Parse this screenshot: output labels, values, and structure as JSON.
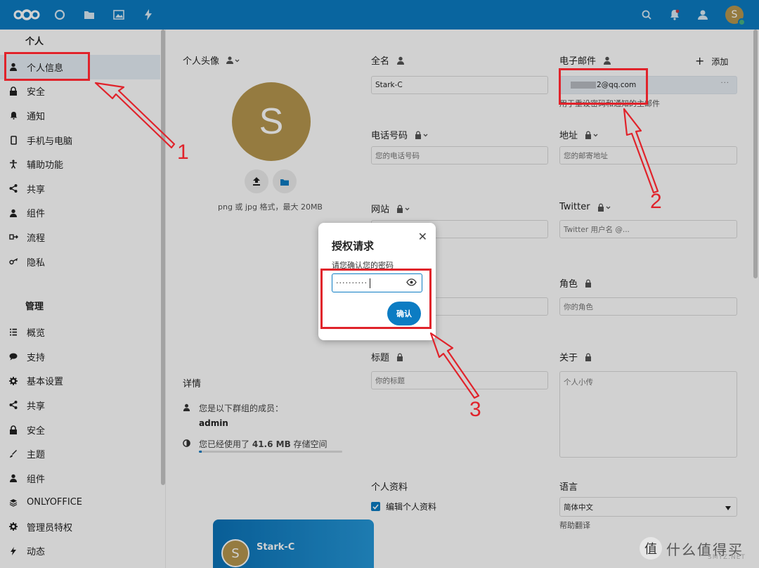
{
  "header": {
    "icons": [
      "nextcloud-logo-icon",
      "dashboard-icon",
      "files-icon",
      "photos-icon",
      "activity-icon",
      "search-icon",
      "notifications-icon",
      "contacts-icon"
    ],
    "avatar_letter": "S"
  },
  "sidebar": {
    "personal_heading": "个人",
    "personal_items": [
      {
        "label": "个人信息",
        "icon": "user-icon"
      },
      {
        "label": "安全",
        "icon": "lock-icon"
      },
      {
        "label": "通知",
        "icon": "bell-icon"
      },
      {
        "label": "手机与电脑",
        "icon": "phone-icon"
      },
      {
        "label": "辅助功能",
        "icon": "accessibility-icon"
      },
      {
        "label": "共享",
        "icon": "share-icon"
      },
      {
        "label": "组件",
        "icon": "group-icon"
      },
      {
        "label": "流程",
        "icon": "flow-icon"
      },
      {
        "label": "隐私",
        "icon": "key-icon"
      }
    ],
    "admin_heading": "管理",
    "admin_items": [
      {
        "label": "概览",
        "icon": "list-icon"
      },
      {
        "label": "支持",
        "icon": "chat-icon"
      },
      {
        "label": "基本设置",
        "icon": "gear-icon"
      },
      {
        "label": "共享",
        "icon": "share-icon"
      },
      {
        "label": "安全",
        "icon": "lock-icon"
      },
      {
        "label": "主题",
        "icon": "brush-icon"
      },
      {
        "label": "组件",
        "icon": "group-icon"
      },
      {
        "label": "ONLYOFFICE",
        "icon": "onlyoffice-icon"
      },
      {
        "label": "管理员特权",
        "icon": "gear-icon"
      },
      {
        "label": "动态",
        "icon": "activity-icon"
      }
    ]
  },
  "profile": {
    "avatar_title": "个人头像",
    "avatar_letter": "S",
    "avatar_hint": "png 或 jpg 格式，最大 20MB",
    "fullname_label": "全名",
    "fullname_value": "Stark-C",
    "email_label": "电子邮件",
    "email_add": "添加",
    "email_value": "2@qq.com",
    "email_hint": "用于重设密码和通知的主邮件",
    "phone_label": "电话号码",
    "phone_placeholder": "您的电话号码",
    "address_label": "地址",
    "address_placeholder": "您的邮寄地址",
    "website_label": "网站",
    "twitter_label": "Twitter",
    "twitter_placeholder": "Twitter 用户名 @...",
    "role_label": "角色",
    "role_placeholder": "你的角色",
    "title_label": "标题",
    "title_placeholder": "你的标题",
    "about_label": "关于",
    "about_placeholder": "个人小传",
    "details_title": "详情",
    "member_text": "您是以下群组的成员：",
    "group_name": "admin",
    "storage_prefix": "您已经使用了",
    "storage_amount": "41.6 MB",
    "storage_suffix": "存储空间",
    "storage_fraction": 0.02,
    "profile_label": "个人资料",
    "edit_profile_label": "编辑个人资料",
    "card_name": "Stark-C",
    "card_letter": "S",
    "language_label": "语言",
    "language_value": "简体中文",
    "help_translate": "帮助翻译"
  },
  "dialog": {
    "title": "授权请求",
    "description": "请您确认您的密码",
    "password_mask": "··········",
    "confirm_label": "确认"
  },
  "annotations": {
    "one": "1",
    "two": "2",
    "three": "3",
    "color": "#e0232b"
  },
  "watermark": {
    "logo_char": "值",
    "text": "什么值得买",
    "sub": "SMYZ.NET"
  }
}
